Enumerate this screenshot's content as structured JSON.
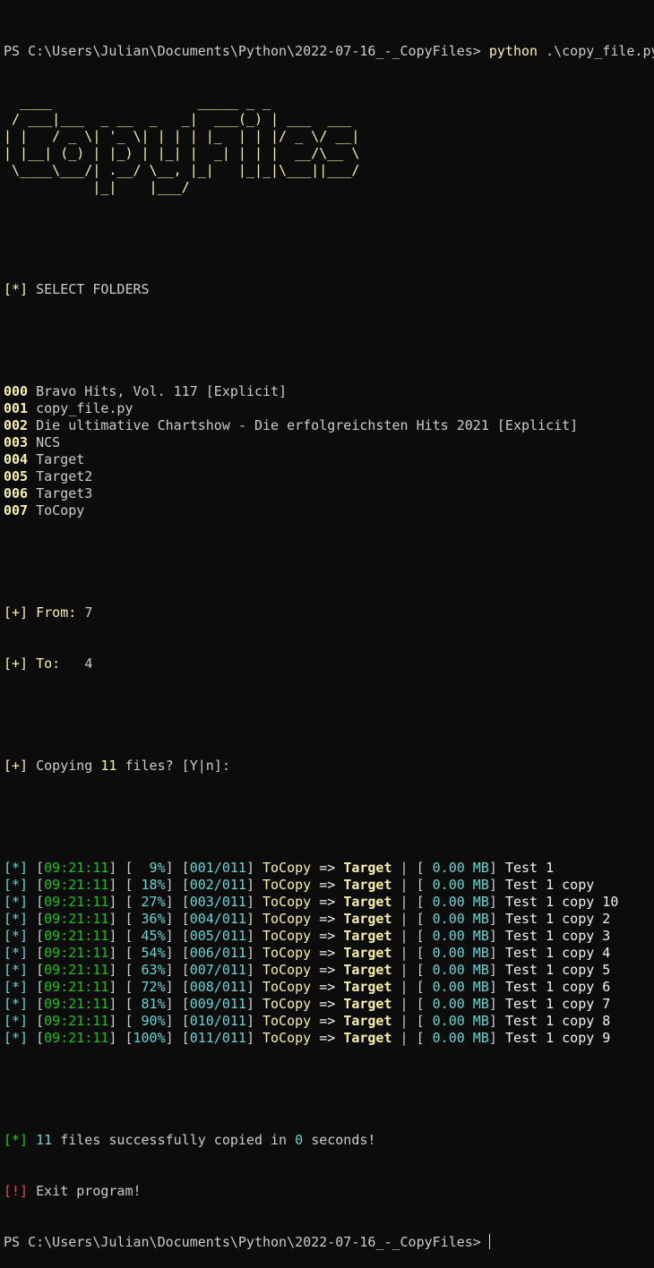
{
  "colors": {
    "background": "#0c0c0c",
    "gray": "#cccccc",
    "white": "#f2f2f2",
    "yellow": "#f9f1a5",
    "cyan": "#61d6d6",
    "green": "#16c60c",
    "red": "#e74856"
  },
  "prompt": "PS C:\\Users\\Julian\\Documents\\Python\\2022-07-16_-_CopyFiles>",
  "command": {
    "program": "python",
    "args": ".\\copy_file.py"
  },
  "banner": [
    "  ____                  _____ _ _",
    " / ___|___  _ __  _   _|  ___(_) | ___  ___",
    "| |   / _ \\| '_ \\| | | | |_  | | |/ _ \\/ __|",
    "| |__| (_) | |_) | |_| |  _| | | |  __/\\__ \\",
    " \\____\\___/| .__/ \\__, |_|   |_|_|\\___||___/",
    "           |_|    |___/"
  ],
  "select_header": {
    "marker": "[*]",
    "text": "SELECT FOLDERS"
  },
  "folders": [
    {
      "index": "000",
      "name": "Bravo Hits, Vol. 117 [Explicit]"
    },
    {
      "index": "001",
      "name": "copy_file.py"
    },
    {
      "index": "002",
      "name": "Die ultimative Chartshow - Die erfolgreichsten Hits 2021 [Explicit]"
    },
    {
      "index": "003",
      "name": "NCS"
    },
    {
      "index": "004",
      "name": "Target"
    },
    {
      "index": "005",
      "name": "Target2"
    },
    {
      "index": "006",
      "name": "Target3"
    },
    {
      "index": "007",
      "name": "ToCopy"
    }
  ],
  "from": {
    "marker": "[+]",
    "label": "From:",
    "value": "7"
  },
  "to": {
    "marker": "[+]",
    "label": "To:  ",
    "value": "4"
  },
  "confirm": {
    "marker": "[+]",
    "pre": "Copying",
    "count": "11",
    "post": "files? [Y|n]:"
  },
  "log": [
    {
      "time": "09:21:11",
      "percent": "  9%",
      "index": "001/011",
      "source": "ToCopy",
      "target": "Target",
      "size": "0.00 MB",
      "file": "Test 1"
    },
    {
      "time": "09:21:11",
      "percent": " 18%",
      "index": "002/011",
      "source": "ToCopy",
      "target": "Target",
      "size": "0.00 MB",
      "file": "Test 1 copy"
    },
    {
      "time": "09:21:11",
      "percent": " 27%",
      "index": "003/011",
      "source": "ToCopy",
      "target": "Target",
      "size": "0.00 MB",
      "file": "Test 1 copy 10"
    },
    {
      "time": "09:21:11",
      "percent": " 36%",
      "index": "004/011",
      "source": "ToCopy",
      "target": "Target",
      "size": "0.00 MB",
      "file": "Test 1 copy 2"
    },
    {
      "time": "09:21:11",
      "percent": " 45%",
      "index": "005/011",
      "source": "ToCopy",
      "target": "Target",
      "size": "0.00 MB",
      "file": "Test 1 copy 3"
    },
    {
      "time": "09:21:11",
      "percent": " 54%",
      "index": "006/011",
      "source": "ToCopy",
      "target": "Target",
      "size": "0.00 MB",
      "file": "Test 1 copy 4"
    },
    {
      "time": "09:21:11",
      "percent": " 63%",
      "index": "007/011",
      "source": "ToCopy",
      "target": "Target",
      "size": "0.00 MB",
      "file": "Test 1 copy 5"
    },
    {
      "time": "09:21:11",
      "percent": " 72%",
      "index": "008/011",
      "source": "ToCopy",
      "target": "Target",
      "size": "0.00 MB",
      "file": "Test 1 copy 6"
    },
    {
      "time": "09:21:11",
      "percent": " 81%",
      "index": "009/011",
      "source": "ToCopy",
      "target": "Target",
      "size": "0.00 MB",
      "file": "Test 1 copy 7"
    },
    {
      "time": "09:21:11",
      "percent": " 90%",
      "index": "010/011",
      "source": "ToCopy",
      "target": "Target",
      "size": "0.00 MB",
      "file": "Test 1 copy 8"
    },
    {
      "time": "09:21:11",
      "percent": "100%",
      "index": "011/011",
      "source": "ToCopy",
      "target": "Target",
      "size": "0.00 MB",
      "file": "Test 1 copy 9"
    }
  ],
  "log_marker": "[*]",
  "arrow": "=>",
  "summary": {
    "marker": "[*]",
    "count": "11",
    "mid": "files successfully copied in",
    "seconds": "0",
    "post": "seconds!"
  },
  "exit": {
    "marker": "[!]",
    "text": "Exit program!"
  }
}
